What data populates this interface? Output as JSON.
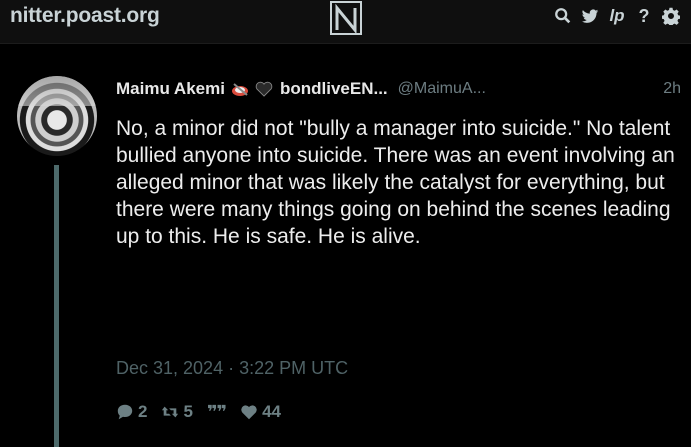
{
  "navbar": {
    "site_name": "nitter.poast.org",
    "logo_icon": "nitter-logo-icon",
    "icons": [
      "search-icon",
      "twitter-bird-icon",
      "lp-icon",
      "help-icon",
      "gear-icon"
    ],
    "lp_label": "lp",
    "help_label": "?"
  },
  "tweet": {
    "fullname": "Maimu Akemi",
    "fullname_suffix": "bondliveEN...",
    "username": "@MaimuA...",
    "time": "2h",
    "body": "No, a minor did not \"bully a manager into suicide.\" No talent bullied anyone into suicide. There was an event involving an alleged minor that was likely the catalyst for everything, but there were many things going on behind the scenes leading up to this. He is safe. He is alive.",
    "date": "Dec 31, 2024 · 3:22 PM UTC",
    "stats": {
      "replies": "2",
      "retweets": "5",
      "quotes": "",
      "likes": "44"
    }
  },
  "colors": {
    "background": "#000000",
    "navbar": "#0f0f0f",
    "accent": "#6d8084",
    "thread_line": "#4d6a6b"
  }
}
